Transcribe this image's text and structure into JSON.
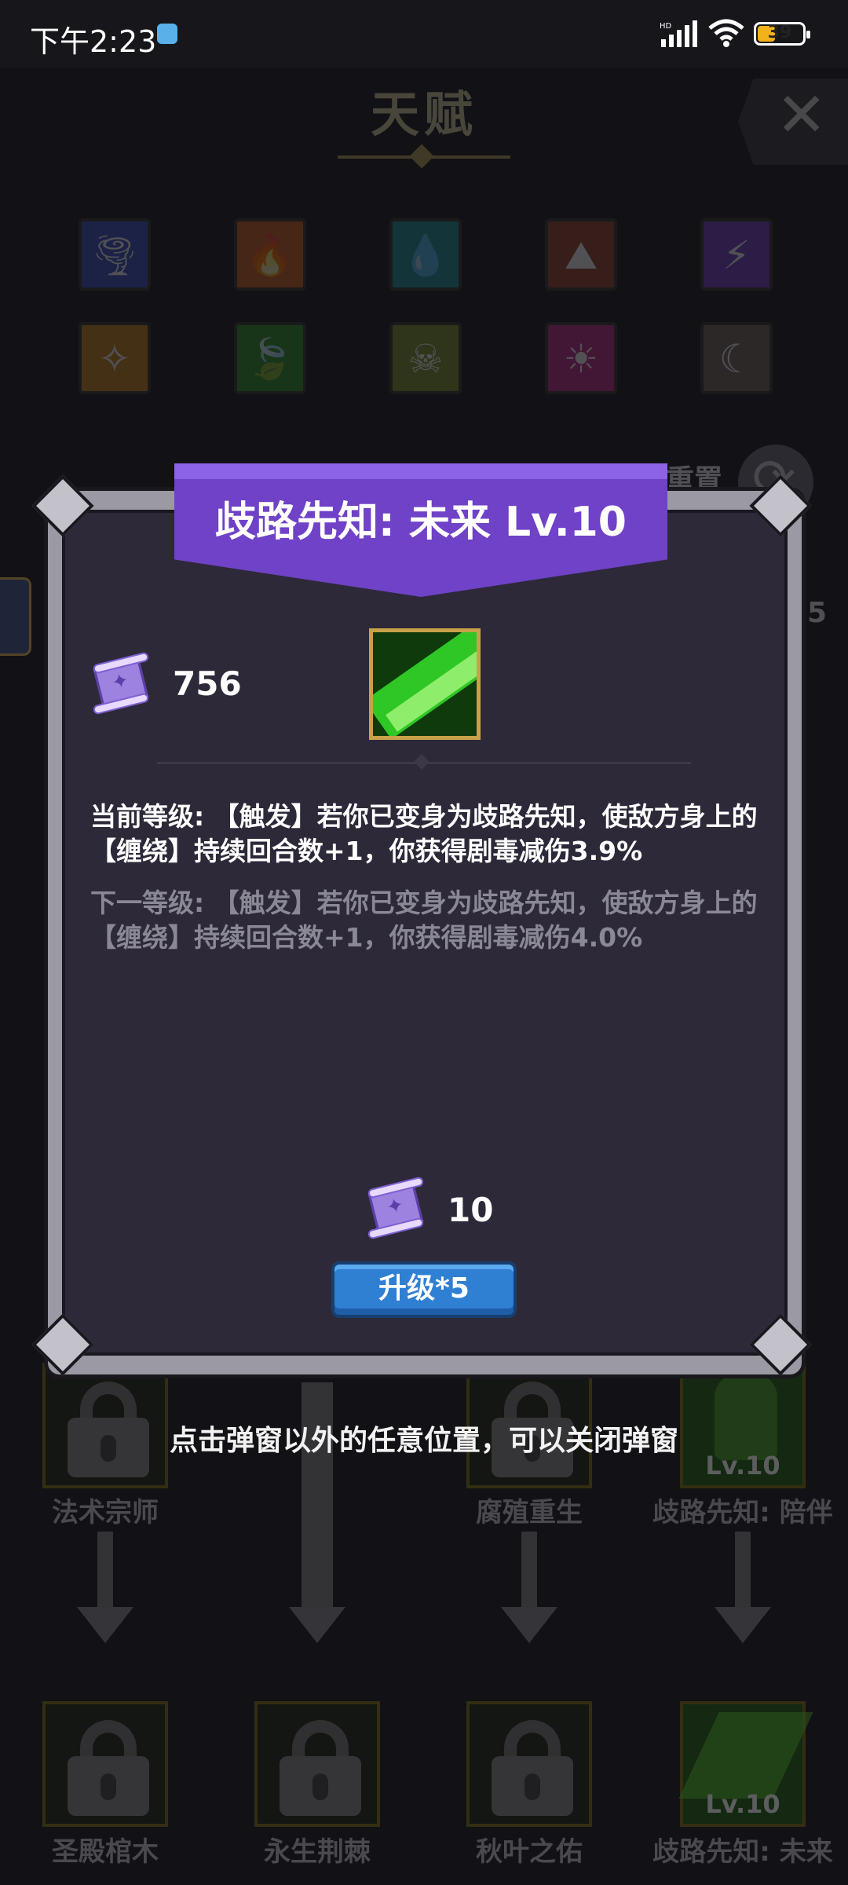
{
  "status_bar": {
    "time": "下午2:23",
    "network": "HD",
    "battery": "39",
    "battery_percent": 39
  },
  "screen": {
    "title": "天赋",
    "reset_label": "重置",
    "side_number": "5"
  },
  "element_icons": [
    {
      "icon": "tornado-icon",
      "color": "#3f58c9",
      "glyph": "🌪"
    },
    {
      "icon": "fire-icon",
      "color": "#d6621e",
      "glyph": "🔥"
    },
    {
      "icon": "water-drop-icon",
      "color": "#1f9a9a",
      "glyph": "💧"
    },
    {
      "icon": "rock-icon",
      "color": "#a0472b",
      "glyph": "⛰"
    },
    {
      "icon": "lightning-icon",
      "color": "#7443c9",
      "glyph": "⚡"
    },
    {
      "icon": "light-icon",
      "color": "#d08c1a",
      "glyph": "✧"
    },
    {
      "icon": "leaf-icon",
      "color": "#2f9a2a",
      "glyph": "🍃"
    },
    {
      "icon": "poison-skull-icon",
      "color": "#7f9a2a",
      "glyph": "☠"
    },
    {
      "icon": "sun-icon",
      "color": "#c72f8e",
      "glyph": "☀"
    },
    {
      "icon": "moon-icon",
      "color": "#7a6a5e",
      "glyph": "☾"
    }
  ],
  "talent_tree": {
    "row1": [
      {
        "label": "法术宗师",
        "locked": true
      },
      {
        "label": "腐殖重生",
        "locked": true
      },
      {
        "label": "歧路先知: 陪伴",
        "locked": false,
        "level": "Lv.10"
      }
    ],
    "row2": [
      {
        "label": "圣殿棺木",
        "locked": true
      },
      {
        "label": "永生荆棘",
        "locked": true
      },
      {
        "label": "秋叶之佑",
        "locked": true
      },
      {
        "label": "歧路先知: 未来",
        "locked": false,
        "level": "Lv.10"
      }
    ]
  },
  "modal": {
    "title": "歧路先知: 未来 Lv.10",
    "owned_scrolls": "756",
    "current_level_text": "当前等级: 【触发】若你已变身为歧路先知，使敌方身上的【缠绕】持续回合数+1，你获得剧毒减伤3.9%",
    "next_level_text": "下一等级: 【触发】若你已变身为歧路先知，使敌方身上的【缠绕】持续回合数+1，你获得剧毒减伤4.0%",
    "cost": "10",
    "upgrade_button": "升级*5"
  },
  "hint": "点击弹窗以外的任意位置，可以关闭弹窗"
}
